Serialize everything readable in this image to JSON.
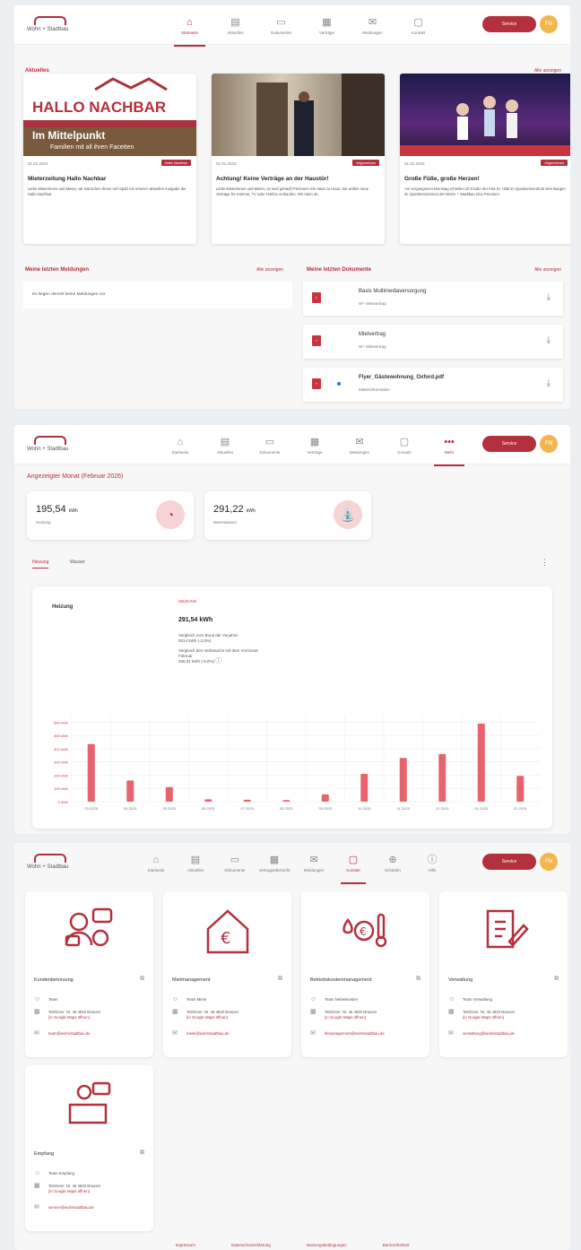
{
  "logo_text": "Wohn + Stadtbau",
  "service_button": "Service",
  "avatar_initials": "FM",
  "panel1": {
    "nav": [
      "Startseite",
      "Aktuelles",
      "Dokumente",
      "Verträge",
      "Meldungen",
      "Kontakt"
    ],
    "news_title": "Aktuelles",
    "news_all": "Alle anzeigen",
    "news": [
      {
        "date": "01.01.2023",
        "tag": "Hallo Nachbar",
        "title": "Mieterzeitung Hallo Nachbar",
        "body": "Liebe Mieterinnen und Mieter, wir wünschen Ihnen viel Spaß mit unserer aktuellen Ausgabe der Hallo Nachbar.",
        "img_headline": "HALLO NACHBAR",
        "img_sub": "Im Mittelpunkt",
        "img_sub2": "Familien mit all ihren Facetten"
      },
      {
        "date": "01.01.2023",
        "tag": "Allgemeines",
        "title": "Achtung! Keine Verträge an der Haustür!",
        "body": "Liebe Mieterinnen und Mieter, es sind gehäuft Personen mit Haus zu Haus. Sie wollen neue Verträge für Internet, TV oder Telefon verkaufen. Wir raten ab."
      },
      {
        "date": "01.01.2023",
        "tag": "Allgemeines",
        "title": "Große Füße, große Herzen!",
        "body": "Am vergangenen Dienstag erhielten 20 Kinder der Kita St. Hildi im Quartierszentrum Drei Burgen im Quartierszentrum der Wohn + Stadtbau eine Premiere."
      }
    ],
    "reports_title": "Meine letzten Meldungen",
    "reports_all": "Alle anzeigen",
    "reports_empty": "Es liegen derzeit keine Meldungen vor.",
    "docs_title": "Meine letzten Dokumente",
    "docs_all": "Alle anzeigen",
    "docs": [
      {
        "name": "Basis Multimediaversorgung",
        "category": "W+ Mietvertrag"
      },
      {
        "name": "Mietvertrag",
        "category": "W+ Mietvertrag"
      },
      {
        "name": "Flyer_Gästewohnung_Oxford.pdf",
        "category": "Mieterinformation"
      }
    ]
  },
  "panel2": {
    "nav": [
      "Startseite",
      "Aktuelles",
      "Dokumente",
      "Verträge",
      "Meldungen",
      "Kontakt",
      "Mehr"
    ],
    "month_title": "Angezeigter Monat (Februar 2026)",
    "kpis": [
      {
        "value": "195,54",
        "unit": "kWh",
        "label": "Heizung"
      },
      {
        "value": "291,22",
        "unit": "kWh",
        "label": "Warmwasser"
      }
    ],
    "tabs": [
      "Heizung",
      "Wasser"
    ],
    "detail_label": "Heizung",
    "detail_kicker": "HEIZUNG",
    "detail_value": "291,54 kWh",
    "cmp1": "Vergleich zum Bund der Vorjahre:",
    "cmp1v": "5014 kWh (-2,0%)",
    "cmp2": "Vergleich des Verbrauchs mit dem Vormonat",
    "cmp2b": "Februar",
    "cmp2v": "306,91 kWh (-5,0%)",
    "chart_data": {
      "type": "bar",
      "categories": [
        "03.2025",
        "04.2025",
        "05.2025",
        "06.2025",
        "07.2025",
        "08.2025",
        "09.2025",
        "10.2025",
        "11.2025",
        "12.2025",
        "01.2026",
        "02.2026"
      ],
      "values": [
        435,
        160,
        110,
        18,
        14,
        12,
        55,
        210,
        330,
        360,
        590,
        195
      ],
      "ylim": [
        0,
        650
      ],
      "yticks": [
        "0 kWh",
        "100 kWh",
        "200 kWh",
        "300 kWh",
        "400 kWh",
        "500 kWh",
        "600 kWh"
      ],
      "color": "#e8636d"
    }
  },
  "panel3": {
    "nav": [
      "Startseite",
      "Aktuelles",
      "Dokumente",
      "Vertragsübersicht",
      "Meldungen",
      "Kontakt",
      "Schäden",
      "Hilfe"
    ],
    "cards": [
      {
        "name": "Kundenbetreuung",
        "person": "Team",
        "phone": "Telefonnr. Nr. 46 4820 Brauser",
        "link": "(in Google Maps öffnen)",
        "email": "team@wohnstadtbau.de"
      },
      {
        "name": "Mietmanagement",
        "person": "Team Miete",
        "phone": "Telefonnr. Nr. 46 4820 Brauser",
        "link": "(in Google Maps öffnen)",
        "email": "miete@wohnstadtbau.de"
      },
      {
        "name": "Betriebskostenmanagement",
        "person": "Team Nebenkosten",
        "phone": "Telefonnr. Nr. 46 4820 Brauser",
        "link": "(in Google Maps öffnen)",
        "email": "bkmanagement@wohnstadtbau.de"
      },
      {
        "name": "Verwaltung",
        "person": "Team Verwaltung",
        "phone": "Telefonnr. Nr. 46 4820 Brauser",
        "link": "(in Google Maps öffnen)",
        "email": "verwaltung@wohnstadtbau.de"
      },
      {
        "name": "Empfang",
        "person": "Team Empfang",
        "phone": "Telefonnr. Nr. 46 4820 Brauser",
        "link": "(in Google Maps öffnen)",
        "email": "service@wohnstadtbau.de"
      }
    ],
    "footer": [
      "Impressum",
      "Datenschutzerklärung",
      "Nutzungsbedingungen",
      "Barrierefreiheit"
    ]
  }
}
